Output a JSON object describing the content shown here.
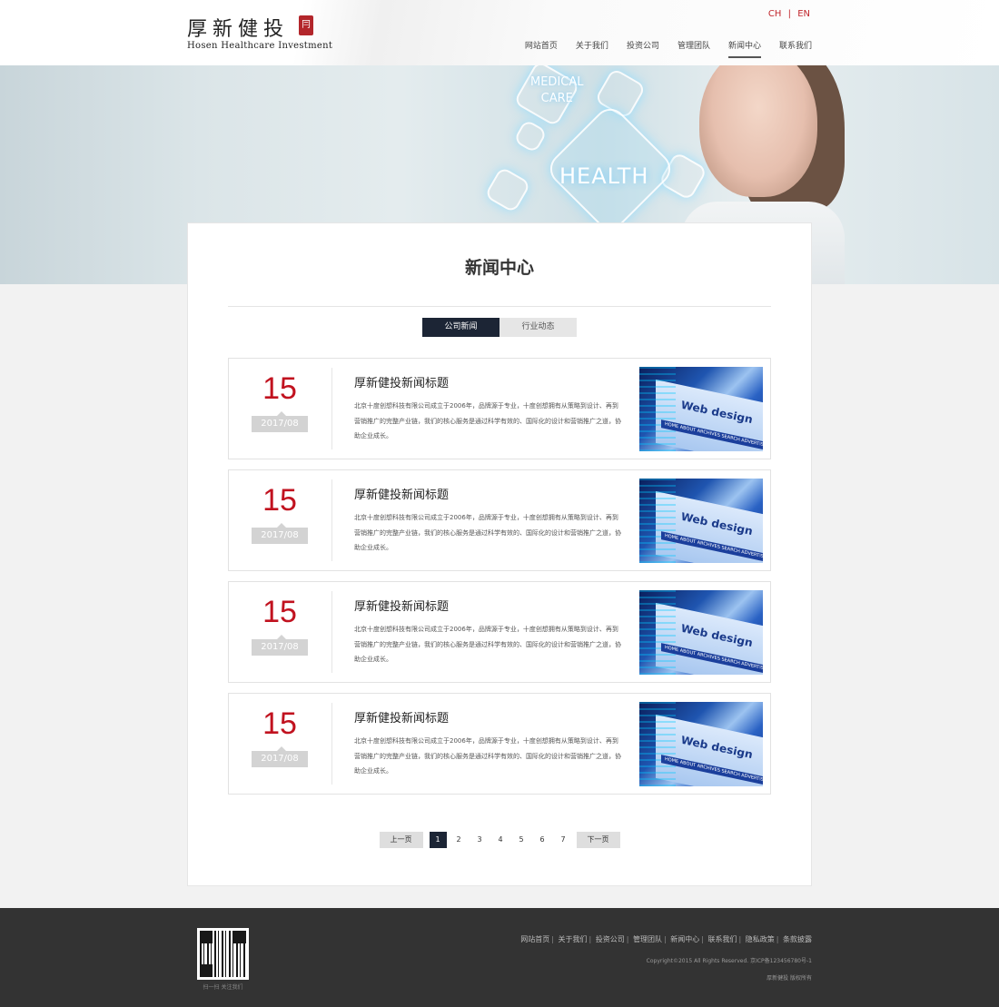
{
  "header": {
    "logo_cn": "厚新健投",
    "logo_seal": "冃",
    "logo_en": "Hosen Healthcare Investment",
    "lang": {
      "ch": "CH",
      "sep": "|",
      "en": "EN"
    },
    "nav": [
      {
        "label": "网站首页"
      },
      {
        "label": "关于我们"
      },
      {
        "label": "投资公司"
      },
      {
        "label": "管理团队"
      },
      {
        "label": "新闻中心",
        "active": true
      },
      {
        "label": "联系我们"
      }
    ]
  },
  "banner": {
    "medical_line1": "MEDICAL",
    "medical_line2": "CARE",
    "health": "HEALTH"
  },
  "main": {
    "title": "新闻中心",
    "tabs": [
      {
        "label": "公司新闻",
        "active": true
      },
      {
        "label": "行业动态"
      }
    ],
    "news": [
      {
        "day": "15",
        "month": "2017/08",
        "title": "厚新健投新闻标题",
        "body": "北京十度创想科技有限公司成立于2006年，品牌源于专业，十度创想拥有从策略到设计、再到营销推广的完整产业链，我们的核心服务是通过科学有效的、国际化的设计和营销推广之道，协助企业成长。",
        "img_logo": "Web design",
        "img_bar": "HOME  ABOUT  ARCHIVES  SEARCH  ADVERTISE"
      },
      {
        "day": "15",
        "month": "2017/08",
        "title": "厚新健投新闻标题",
        "body": "北京十度创想科技有限公司成立于2006年，品牌源于专业，十度创想拥有从策略到设计、再到营销推广的完整产业链，我们的核心服务是通过科学有效的、国际化的设计和营销推广之道，协助企业成长。",
        "img_logo": "Web design",
        "img_bar": "HOME  ABOUT  ARCHIVES  SEARCH  ADVERTISE"
      },
      {
        "day": "15",
        "month": "2017/08",
        "title": "厚新健投新闻标题",
        "body": "北京十度创想科技有限公司成立于2006年，品牌源于专业，十度创想拥有从策略到设计、再到营销推广的完整产业链，我们的核心服务是通过科学有效的、国际化的设计和营销推广之道，协助企业成长。",
        "img_logo": "Web design",
        "img_bar": "HOME  ABOUT  ARCHIVES  SEARCH  ADVERTISE"
      },
      {
        "day": "15",
        "month": "2017/08",
        "title": "厚新健投新闻标题",
        "body": "北京十度创想科技有限公司成立于2006年，品牌源于专业，十度创想拥有从策略到设计、再到营销推广的完整产业链，我们的核心服务是通过科学有效的、国际化的设计和营销推广之道，协助企业成长。",
        "img_logo": "Web design",
        "img_bar": "HOME  ABOUT  ARCHIVES  SEARCH  ADVERTISE"
      }
    ],
    "pager": {
      "prev": "上一页",
      "next": "下一页",
      "pages": [
        "1",
        "2",
        "3",
        "4",
        "5",
        "6",
        "7"
      ],
      "current": "1"
    }
  },
  "footer": {
    "qr_caption": "扫一扫  关注我们",
    "links": [
      "网站首页",
      "关于我们",
      "投资公司",
      "管理团队",
      "新闻中心",
      "联系我们",
      "隐私政策",
      "条款披露"
    ],
    "copyright": "Copyright©2015 All Rights Reserved. 京ICP备123456780号-1",
    "rights": "厚新健投 版权所有"
  },
  "colors": {
    "accent_red": "#c1121f",
    "active_dark": "#1c2535",
    "footer_bg": "#333333"
  }
}
